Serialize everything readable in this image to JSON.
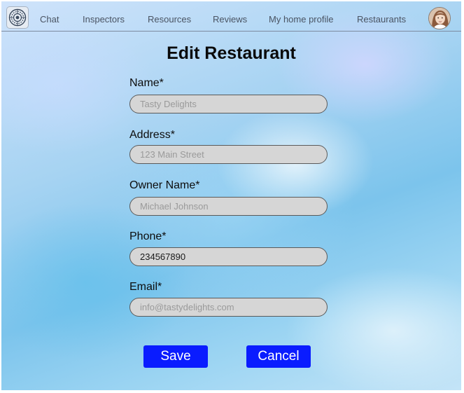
{
  "nav": {
    "logo_icon": "mandala-logo-icon",
    "items": [
      "Chat",
      "Inspectors",
      "Resources",
      "Reviews",
      "My home profile",
      "Restaurants"
    ],
    "avatar_icon": "user-avatar"
  },
  "form": {
    "title": "Edit Restaurant",
    "fields": [
      {
        "label": "Name*",
        "value": "",
        "placeholder": "Tasty Delights"
      },
      {
        "label": "Address*",
        "value": "",
        "placeholder": "123 Main Street"
      },
      {
        "label": "Owner Name*",
        "value": "",
        "placeholder": "Michael Johnson"
      },
      {
        "label": "Phone*",
        "value": "234567890",
        "placeholder": ""
      },
      {
        "label": "Email*",
        "value": "",
        "placeholder": "info@tastydelights.com"
      }
    ],
    "save_label": "Save",
    "cancel_label": "Cancel"
  },
  "colors": {
    "button": "#0a1cff",
    "field_bg": "#d6d6d6"
  }
}
